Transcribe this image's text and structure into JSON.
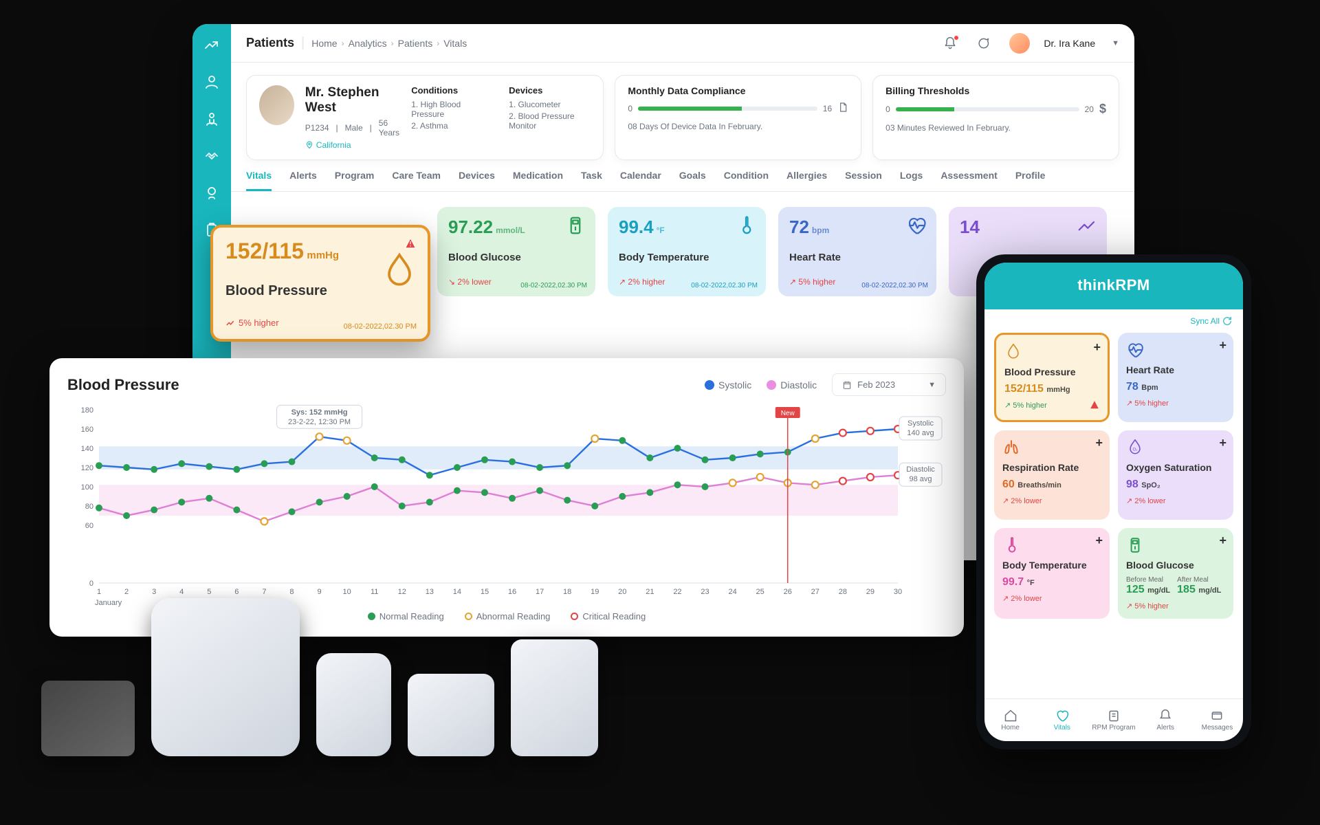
{
  "colors": {
    "accent": "#19b6bd",
    "green": "#35b24e",
    "red": "#e14545",
    "amber": "#e7972a"
  },
  "top": {
    "section": "Patients",
    "crumbs": [
      "Home",
      "Analytics",
      "Patients",
      "Vitals"
    ],
    "user_name": "Dr. Ira Kane"
  },
  "patient": {
    "name": "Mr. Stephen West",
    "id": "P1234",
    "gender": "Male",
    "age": "56 Years",
    "location": "California",
    "conditions_label": "Conditions",
    "conditions": [
      "1. High Blood Pressure",
      "2. Asthma"
    ],
    "devices_label": "Devices",
    "devices": [
      "1. Glucometer",
      "2. Blood Pressure Monitor"
    ]
  },
  "kpi": {
    "compliance": {
      "title": "Monthly Data Compliance",
      "min": "0",
      "max": "16",
      "pct": 58,
      "sub": "08 Days Of Device Data In February."
    },
    "billing": {
      "title": "Billing Thresholds",
      "min": "0",
      "max": "20",
      "pct": 32,
      "sub": "03 Minutes Reviewed In February."
    }
  },
  "tabs": [
    "Vitals",
    "Alerts",
    "Program",
    "Care Team",
    "Devices",
    "Medication",
    "Task",
    "Calendar",
    "Goals",
    "Condition",
    "Allergies",
    "Session",
    "Logs",
    "Assessment",
    "Profile"
  ],
  "big_bp": {
    "value": "152/115",
    "unit": "mmHg",
    "label": "Blood Pressure",
    "trend": "5% higher",
    "timestamp": "08-02-2022,02.30 PM"
  },
  "vitals": [
    {
      "key": "glucose",
      "bg": "#dcf3df",
      "fg": "#2a9d55",
      "value": "97.22",
      "unit": "mmol/L",
      "label": "Blood Glucose",
      "trend": "2% lower",
      "trend_dir": "down",
      "ts": "08-02-2022,02.30 PM"
    },
    {
      "key": "temp",
      "bg": "#d9f3fa",
      "fg": "#1b9fc0",
      "value": "99.4",
      "unit": "°F",
      "label": "Body Temperature",
      "trend": "2% higher",
      "trend_dir": "up",
      "ts": "08-02-2022,02.30 PM"
    },
    {
      "key": "hr",
      "bg": "#dbe4f8",
      "fg": "#3a66c7",
      "value": "72",
      "unit": "bpm",
      "label": "Heart Rate",
      "trend": "5% higher",
      "trend_dir": "up",
      "ts": "08-02-2022,02.30 PM"
    },
    {
      "key": "more",
      "bg": "#eadefa",
      "fg": "#7a4fcf",
      "value": "14",
      "unit": "",
      "label": "",
      "trend": "",
      "trend_dir": "",
      "ts": ""
    }
  ],
  "chart": {
    "title": "Blood Pressure",
    "legend_sys": "Systolic",
    "legend_dia": "Diastolic",
    "date_range": "Feb 2023",
    "month_label": "January",
    "tooltip_line1": "Sys: 152 mmHg",
    "tooltip_line2": "23-2-22, 12:30 PM",
    "sys_avg_label": "Systolic",
    "sys_avg_value": "140 avg",
    "dia_avg_label": "Diastolic",
    "dia_avg_value": "98 avg",
    "new_tag": "New",
    "legend_normal": "Normal Reading",
    "legend_abnormal": "Abnormal Reading",
    "legend_critical": "Critical Reading"
  },
  "chart_data": {
    "type": "line",
    "title": "Blood Pressure",
    "xlabel": "",
    "ylabel": "",
    "ylim": [
      0,
      180
    ],
    "y_ticks": [
      0,
      60,
      80,
      100,
      120,
      140,
      160,
      180
    ],
    "categories": [
      1,
      2,
      3,
      4,
      5,
      6,
      7,
      8,
      9,
      10,
      11,
      12,
      13,
      14,
      15,
      16,
      17,
      18,
      19,
      20,
      21,
      22,
      23,
      24,
      25,
      26,
      27,
      28,
      29,
      30
    ],
    "series": [
      {
        "name": "Systolic",
        "color": "#2a6fe0",
        "band": [
          118,
          142
        ],
        "values": [
          122,
          120,
          118,
          124,
          121,
          118,
          124,
          126,
          152,
          148,
          130,
          128,
          112,
          120,
          128,
          126,
          120,
          122,
          150,
          148,
          130,
          140,
          128,
          130,
          134,
          136,
          150,
          156,
          158,
          160
        ],
        "status": [
          "normal",
          "normal",
          "normal",
          "normal",
          "normal",
          "normal",
          "normal",
          "normal",
          "abnormal",
          "abnormal",
          "normal",
          "normal",
          "normal",
          "normal",
          "normal",
          "normal",
          "normal",
          "normal",
          "abnormal",
          "normal",
          "normal",
          "normal",
          "normal",
          "normal",
          "normal",
          "normal",
          "abnormal",
          "critical",
          "critical",
          "critical"
        ]
      },
      {
        "name": "Diastolic",
        "color": "#df7ed5",
        "band": [
          70,
          102
        ],
        "values": [
          78,
          70,
          76,
          84,
          88,
          76,
          64,
          74,
          84,
          90,
          100,
          80,
          84,
          96,
          94,
          88,
          96,
          86,
          80,
          90,
          94,
          102,
          100,
          104,
          110,
          104,
          102,
          106,
          110,
          112
        ],
        "status": [
          "normal",
          "normal",
          "normal",
          "normal",
          "normal",
          "normal",
          "abnormal",
          "normal",
          "normal",
          "normal",
          "normal",
          "normal",
          "normal",
          "normal",
          "normal",
          "normal",
          "normal",
          "normal",
          "normal",
          "normal",
          "normal",
          "normal",
          "normal",
          "abnormal",
          "abnormal",
          "abnormal",
          "abnormal",
          "critical",
          "critical",
          "critical"
        ]
      }
    ],
    "now_x": 26
  },
  "phone": {
    "brand_light": "think",
    "brand_bold": "RPM",
    "sync": "Sync All",
    "cards": [
      {
        "key": "bp",
        "bg": "#fdf2dc",
        "fg": "#d78a1e",
        "icon": "drop",
        "label": "Blood Pressure",
        "value": "152/115",
        "unit": "mmHg",
        "trend": "5% higher",
        "trend_color": "#2a9d55",
        "warn": true,
        "highlight": true
      },
      {
        "key": "hr",
        "bg": "#dbe4f8",
        "fg": "#3a66c7",
        "icon": "heart",
        "label": "Heart Rate",
        "value": "78",
        "unit": "Bpm",
        "trend": "5% higher",
        "trend_color": "#e14545"
      },
      {
        "key": "rr",
        "bg": "#fde3d7",
        "fg": "#e06a2b",
        "icon": "lungs",
        "label": "Respiration Rate",
        "value": "60",
        "unit": "Breaths/min",
        "trend": "2% lower",
        "trend_color": "#e14545"
      },
      {
        "key": "spo2",
        "bg": "#eadefa",
        "fg": "#7a4fcf",
        "icon": "o2",
        "label": "Oxygen Saturation",
        "value": "98",
        "unit": "SpO₂",
        "trend": "2% lower",
        "trend_color": "#e14545"
      },
      {
        "key": "temp",
        "bg": "#fddcee",
        "fg": "#d94aa0",
        "icon": "temp",
        "label": "Body Temperature",
        "value": "99.7",
        "unit": "°F",
        "trend": "2% lower",
        "trend_color": "#e14545"
      },
      {
        "key": "glucose",
        "bg": "#dcf3df",
        "fg": "#2a9d55",
        "icon": "glucose",
        "label": "Blood Glucose",
        "before_label": "Before Meal",
        "after_label": "After Meal",
        "before": "125",
        "after": "185",
        "unit": "mg/dL",
        "trend": "5% higher",
        "trend_color": "#e14545"
      }
    ],
    "nav": [
      "Home",
      "Vitals",
      "RPM Program",
      "Alerts",
      "Messages"
    ],
    "nav_active": 1
  }
}
